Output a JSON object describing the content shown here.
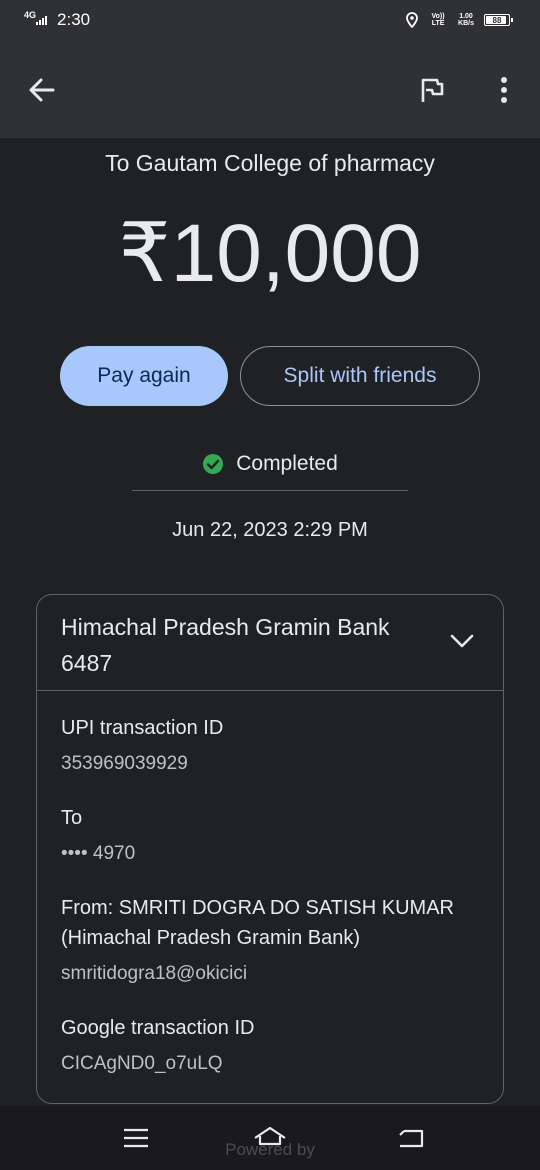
{
  "status_bar": {
    "network": "4G",
    "time": "2:30",
    "volte": "Vo)) LTE",
    "speed_value": "1.00",
    "speed_unit": "KB/s",
    "battery": "88"
  },
  "app_bar": {
    "back_icon": "arrow-left-icon",
    "flag_icon": "flag-icon",
    "more_icon": "more-vertical-icon"
  },
  "payment": {
    "recipient": "To Gautam College of pharmacy",
    "amount": "₹10,000",
    "pay_again_label": "Pay again",
    "split_label": "Split with friends",
    "status": "Completed",
    "datetime": "Jun 22, 2023 2:29 PM"
  },
  "details": {
    "bank_name": "Himachal Pradesh Gramin Bank 6487",
    "upi_label": "UPI transaction ID",
    "upi_value": "353969039929",
    "to_label": "To",
    "to_value": "•••• 4970",
    "from_label": "From: SMRITI DOGRA DO SATISH KUMAR (Himachal Pradesh Gramin Bank)",
    "from_value": "smritidogra18@okicici",
    "google_label": "Google transaction ID",
    "google_value": "CICAgND0_o7uLQ"
  },
  "footer": {
    "powered_text": "Powered by"
  },
  "colors": {
    "background": "#202124",
    "app_bar": "#303134",
    "primary_button": "#a8c7fa",
    "success": "#34a853"
  }
}
